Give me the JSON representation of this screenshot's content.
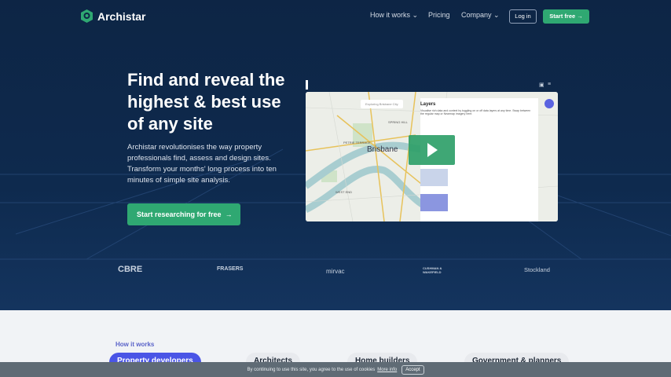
{
  "nav": {
    "brand": "Archistar",
    "items": [
      "How it works",
      "Pricing",
      "Company"
    ],
    "login": "Log in",
    "start": "Start free"
  },
  "hero": {
    "title": "Find and reveal the highest & best use of any site",
    "description": "Archistar revolutionises the way property professionals find, assess and design sites. Transform your months' long process into ten minutes of simple site analysis.",
    "cta": "Start researching for free"
  },
  "video": {
    "map_label": "Brisbane",
    "search": "Exploring Brisbane City",
    "panel_title": "Layers",
    "panel_desc": "Visualise rich data and context by toggling on or off data layers at any time. Swap between the regular map or Nearmap imagery here.",
    "places": [
      "SPRING HILL",
      "PETRIE TERRACE",
      "WEST END"
    ]
  },
  "partners": [
    "CBRE",
    "FRASERS",
    "mirvac",
    "CUSHMAN & WAKEFIELD",
    "Stockland"
  ],
  "how": {
    "label": "How it works",
    "tabs": [
      "Property developers",
      "Architects",
      "Home builders",
      "Government & planners"
    ]
  },
  "cookie": {
    "text": "By continuing to use this site, you agree to the use of cookies",
    "more": "More info",
    "accept": "Accept"
  },
  "colors": {
    "navy": "#0d2545",
    "green": "#2fa872",
    "accent": "#5a63c9"
  }
}
